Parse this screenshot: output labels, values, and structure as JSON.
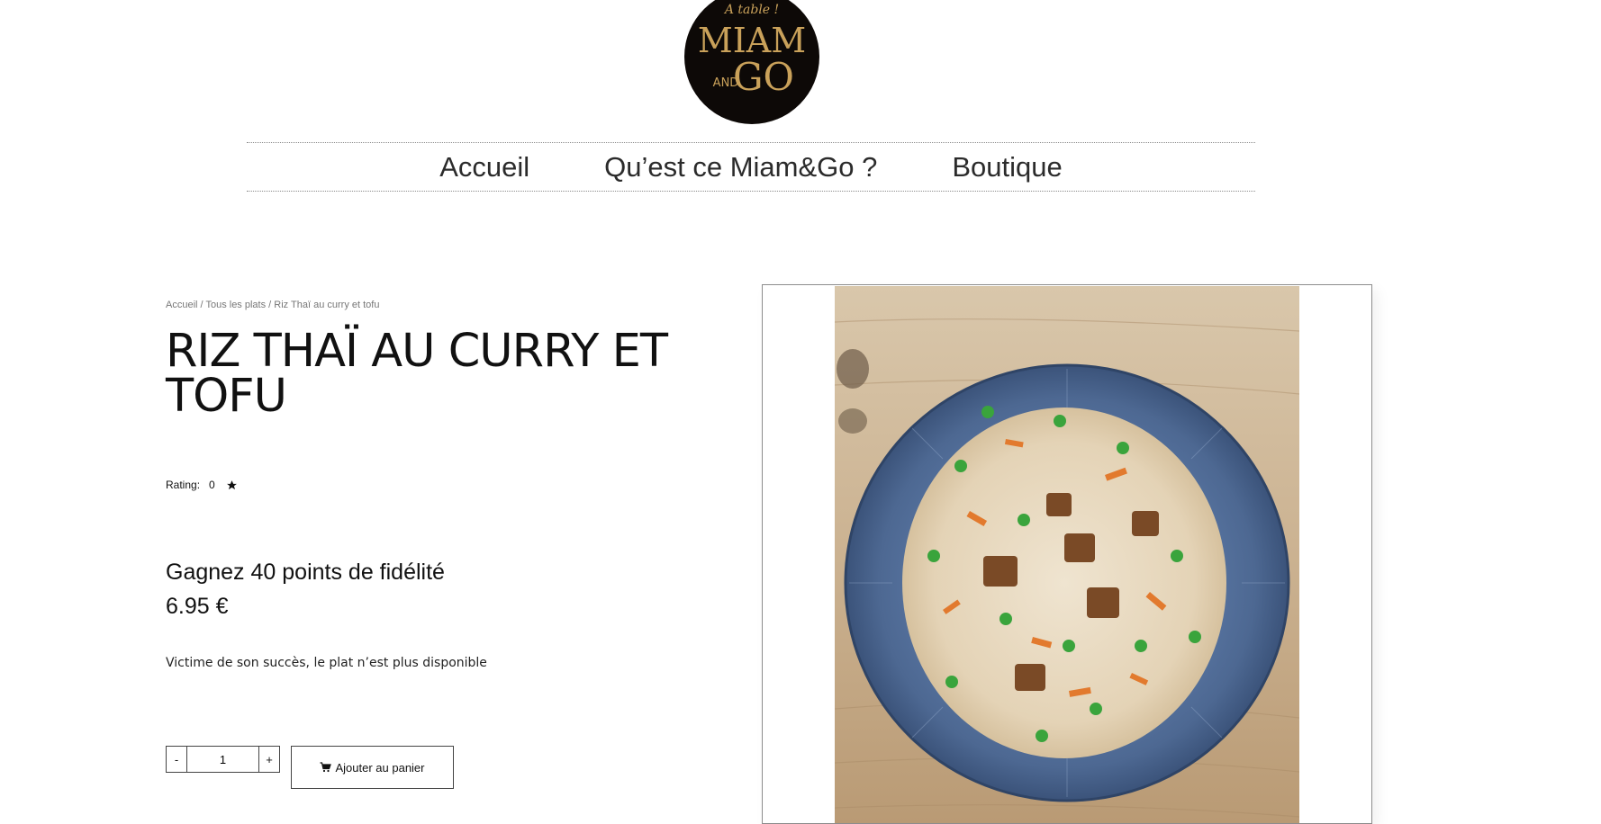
{
  "brand": {
    "logo_tagline": "A table !",
    "logo_line1": "MIAM",
    "logo_and": "AND",
    "logo_line2": "GO",
    "logo_bg": "#0d0907",
    "logo_gold": "#c9a15a"
  },
  "nav": {
    "items": [
      {
        "label": "Accueil"
      },
      {
        "label": "Qu’est ce Miam&Go ?"
      },
      {
        "label": "Boutique"
      }
    ]
  },
  "breadcrumb": {
    "home": "Accueil",
    "sep1": " / ",
    "category": "Tous les plats",
    "sep2": " / ",
    "current": "Riz Thaï au curry et tofu"
  },
  "product": {
    "title": "RIZ THAÏ AU CURRY ET TOFU",
    "rating_label": "Rating:",
    "rating_value": "0",
    "rating_icon": "star-icon",
    "points": "Gagnez 40 points de fidélité",
    "price": "6.95 €",
    "availability": "Victime de son succès, le plat n’est plus disponible",
    "image_alt": "Riz thaï au curry et tofu dans une assiette bleue"
  },
  "cart": {
    "minus_label": "-",
    "quantity": "1",
    "plus_label": "+",
    "add_label": "Ajouter au panier",
    "add_icon": "cart-icon"
  }
}
